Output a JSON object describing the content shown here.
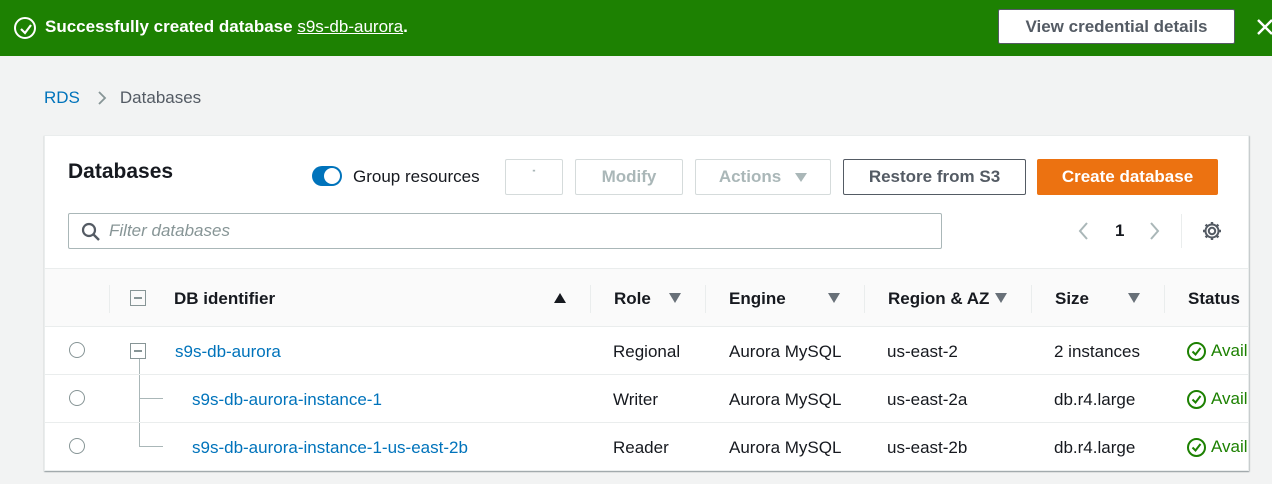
{
  "flash": {
    "prefix": "Successfully created database",
    "db_link": "s9s-db-aurora",
    "suffix": ".",
    "button": "View credential details"
  },
  "breadcrumb": {
    "root": "RDS",
    "current": "Databases"
  },
  "panel": {
    "title": "Databases",
    "group_resources": "Group resources",
    "buttons": {
      "refresh": "˙",
      "modify": "Modify",
      "actions": "Actions",
      "restore": "Restore from S3",
      "create": "Create database"
    },
    "filter_placeholder": "Filter databases",
    "page": "1"
  },
  "table": {
    "headers": {
      "db_identifier": "DB identifier",
      "role": "Role",
      "engine": "Engine",
      "region": "Region & AZ",
      "size": "Size",
      "status": "Status"
    },
    "rows": [
      {
        "id": "s9s-db-aurora",
        "role": "Regional",
        "engine": "Aurora MySQL",
        "region": "us-east-2",
        "size": "2 instances",
        "status": "Avail"
      },
      {
        "id": "s9s-db-aurora-instance-1",
        "role": "Writer",
        "engine": "Aurora MySQL",
        "region": "us-east-2a",
        "size": "db.r4.large",
        "status": "Avail"
      },
      {
        "id": "s9s-db-aurora-instance-1-us-east-2b",
        "role": "Reader",
        "engine": "Aurora MySQL",
        "region": "us-east-2b",
        "size": "db.r4.large",
        "status": "Avail"
      }
    ]
  },
  "colors": {
    "success": "#1d8102",
    "link": "#0073bb",
    "primary": "#ec7211"
  },
  "icons": [
    "success-check-icon",
    "close-icon",
    "chevron-right-icon",
    "search-icon",
    "chevron-left-icon",
    "settings-gear-icon",
    "sort-icon",
    "collapse-icon",
    "status-ok-icon"
  ]
}
